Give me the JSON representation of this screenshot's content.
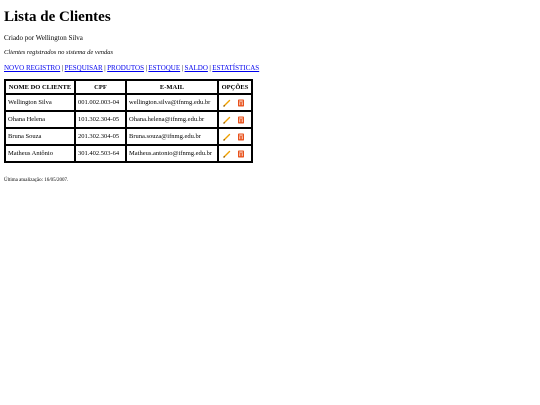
{
  "title": "Lista de Clientes",
  "author": "Criado por Wellington Silva",
  "subtitle": "Clientes registrados no sistema de vendas",
  "nav": {
    "links": [
      "NOVO REGISTRO",
      "PESQUISAR",
      "PRODUTOS",
      "ESTOQUE",
      "SALDO",
      "ESTATÍSTICAS"
    ],
    "separator": "|"
  },
  "table": {
    "headers": [
      "NOME DO CLIENTE",
      "CPF",
      "E-MAIL",
      "OPÇÕES"
    ],
    "rows": [
      {
        "name": "Wellington Silva",
        "cpf": "001.002.003-04",
        "email": "wellington.silva@ifnmg.edu.br"
      },
      {
        "name": "Ohana Helena",
        "cpf": "101.302.304-05",
        "email": "Ohana.helena@ifnmg.edu.br"
      },
      {
        "name": "Bruna Souza",
        "cpf": "201.302.304-05",
        "email": "Bruna.souza@ifnmg.edu.br"
      },
      {
        "name": "Matheus Antônio",
        "cpf": "301.402.503-64",
        "email": "Matheus.antonio@ifnmg.edu.br"
      }
    ]
  },
  "icons": {
    "edit": "pencil-icon",
    "delete": "trash-icon"
  },
  "colors": {
    "link": "#0000ee",
    "pencil": "#f0a000",
    "trash": "#e8501a"
  },
  "footer": "Última atualização: 16/05/2007."
}
